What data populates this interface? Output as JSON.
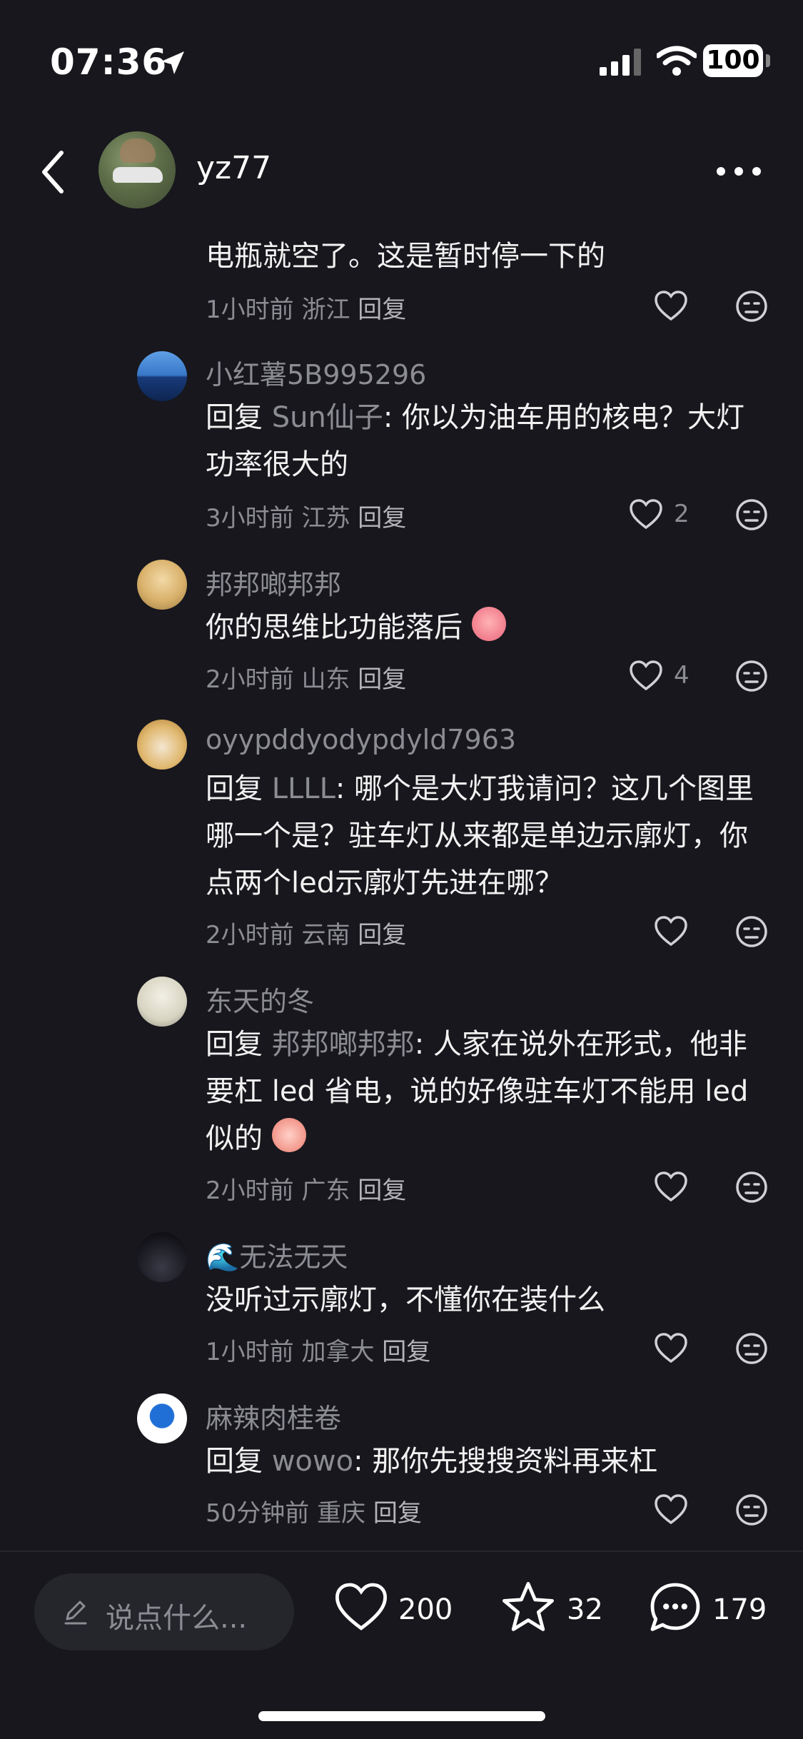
{
  "status_bar": {
    "time": "07:36",
    "battery": "100"
  },
  "header": {
    "author_name": "yz77"
  },
  "comments": [
    {
      "name": "",
      "text": "电瓶就空了。这是暂时停一下的",
      "time": "1小时前",
      "location": "浙江",
      "reply_label": "回复",
      "likes": ""
    },
    {
      "name": "小红薯5B995296",
      "prefix": "回复",
      "reply_to": "Sun仙子",
      "text": ": 你以为油车用的核电？大灯功率很大的",
      "time": "3小时前",
      "location": "江苏",
      "reply_label": "回复",
      "likes": "2"
    },
    {
      "name": "邦邦啷邦邦",
      "text": "你的思维比功能落后",
      "time": "2小时前",
      "location": "山东",
      "reply_label": "回复",
      "likes": "4"
    },
    {
      "name": "oyypddyodypdyld7963",
      "prefix": "回复",
      "reply_to": "LLLL",
      "text": ": 哪个是大灯我请问？这几个图里哪一个是？驻车灯从来都是单边示廓灯，你点两个led示廓灯先进在哪？",
      "time": "2小时前",
      "location": "云南",
      "reply_label": "回复",
      "likes": ""
    },
    {
      "name": "东天的冬",
      "prefix": "回复",
      "reply_to": "邦邦啷邦邦",
      "text": ": 人家在说外在形式，他非要杠 led 省电，说的好像驻车灯不能用 led 似的",
      "time": "2小时前",
      "location": "广东",
      "reply_label": "回复",
      "likes": ""
    },
    {
      "name": "无法无天",
      "name_emoji": "🌊",
      "text": "没听过示廓灯，不懂你在装什么",
      "time": "1小时前",
      "location": "加拿大",
      "reply_label": "回复",
      "likes": ""
    },
    {
      "name": "麻辣肉桂卷",
      "prefix": "回复",
      "reply_to": "wowo",
      "text": ": 那你先搜搜资料再来杠",
      "time": "50分钟前",
      "location": "重庆",
      "reply_label": "回复",
      "likes": ""
    }
  ],
  "bottom_bar": {
    "input_placeholder": "说点什么...",
    "like_count": "200",
    "favorite_count": "32",
    "comment_count": "179"
  },
  "colors": {
    "background": "#17171d",
    "secondary_text": "#8c8c93",
    "icon": "#d0d0d5"
  }
}
